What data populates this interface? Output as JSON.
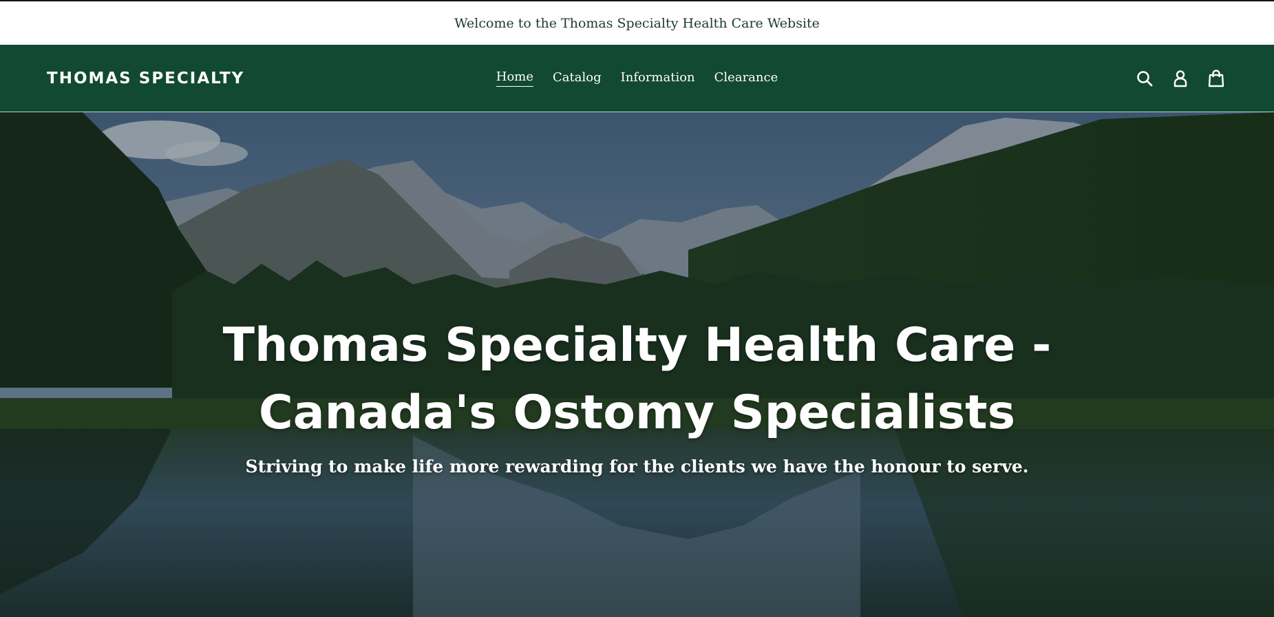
{
  "announcement": {
    "text": "Welcome to the Thomas Specialty Health Care Website"
  },
  "header": {
    "logo": "THOMAS SPECIALTY",
    "nav": [
      {
        "label": "Home",
        "active": true
      },
      {
        "label": "Catalog",
        "active": false
      },
      {
        "label": "Information",
        "active": false
      },
      {
        "label": "Clearance",
        "active": false
      }
    ],
    "icons": [
      "search-icon",
      "account-icon",
      "cart-icon"
    ]
  },
  "hero": {
    "title": "Thomas Specialty Health Care - Canada's Ostomy Specialists",
    "subtitle": "Striving to make life more rewarding for the clients we have the honour to serve."
  },
  "colors": {
    "header_bg": "#124932",
    "announcement_text": "#1d3a2a",
    "text_light": "#ffffff"
  }
}
